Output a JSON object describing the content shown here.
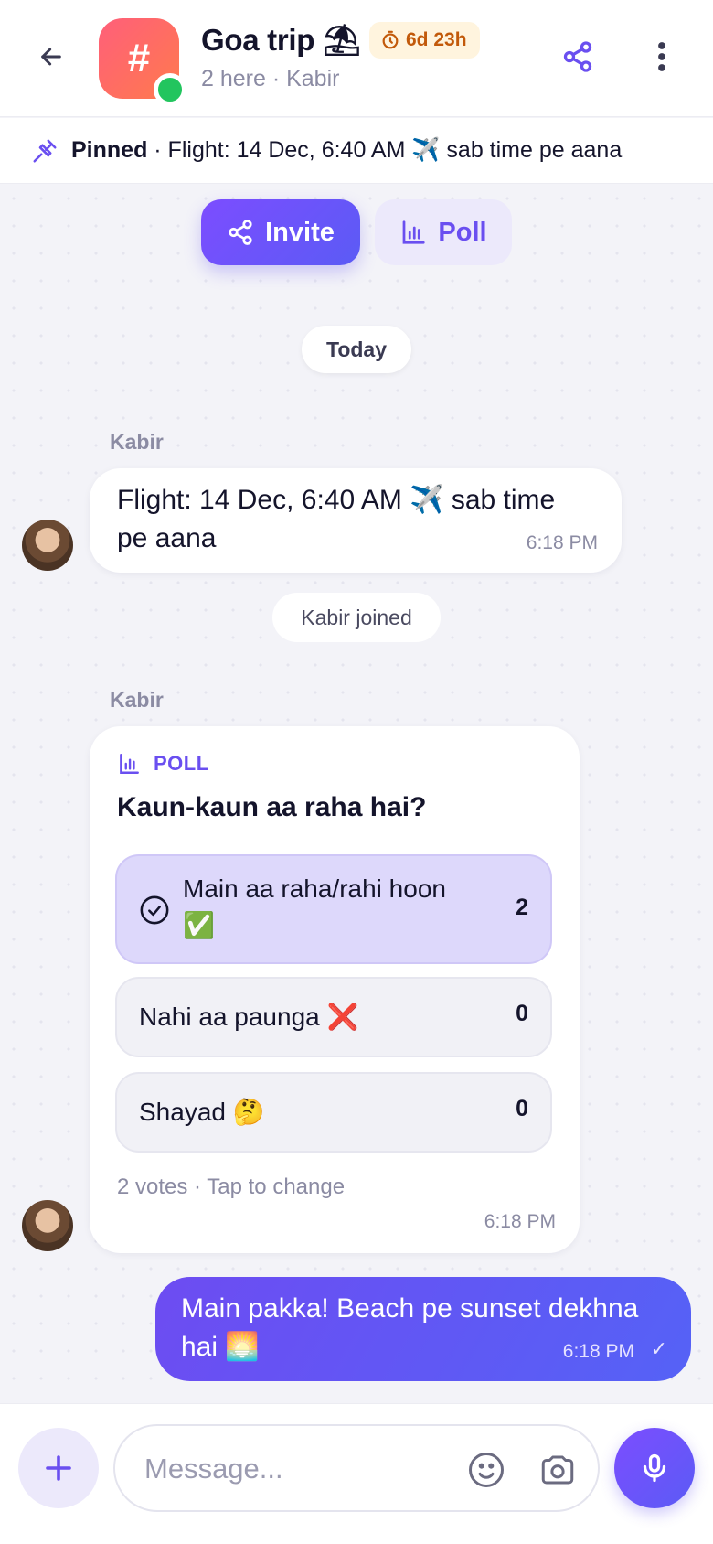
{
  "header": {
    "title": "Goa trip",
    "title_emoji": "⛱",
    "avatar_symbol": "#",
    "timer": "6d 23h",
    "subtitle": "2 here · Kabir"
  },
  "pinned": {
    "label": "Pinned",
    "text": " · Flight: 14 Dec, 6:40 AM ✈️  sab time pe aana"
  },
  "actions": {
    "invite_label": "Invite",
    "poll_label": "Poll"
  },
  "chat": {
    "date_divider": "Today",
    "messages": [
      {
        "sender": "Kabir",
        "lines": [
          "Flight: 14 Dec, 6:40 AM ✈️  sab time",
          "pe aana"
        ],
        "time": "6:18 PM"
      }
    ],
    "system_message": "Kabir joined",
    "poll": {
      "sender": "Kabir",
      "label": "POLL",
      "question": "Kaun-kaun aa raha hai?",
      "options": [
        {
          "text_line1": "Main aa raha/rahi hoon",
          "text_line2": "✅",
          "count": "2",
          "selected": true
        },
        {
          "text": "Nahi aa paunga ❌",
          "count": "0",
          "selected": false
        },
        {
          "text": "Shayad 🤔",
          "count": "0",
          "selected": false
        }
      ],
      "footer": "2 votes · Tap to change",
      "time": "6:18 PM"
    },
    "own_message": {
      "lines": [
        "Main pakka! Beach pe sunset dekhna",
        "hai 🌅"
      ],
      "time": "6:18 PM",
      "status": "✓"
    }
  },
  "composer": {
    "placeholder": "Message..."
  },
  "colors": {
    "accent": "#6a4ff0",
    "online": "#22c55e",
    "timer_text": "#c2590a"
  }
}
